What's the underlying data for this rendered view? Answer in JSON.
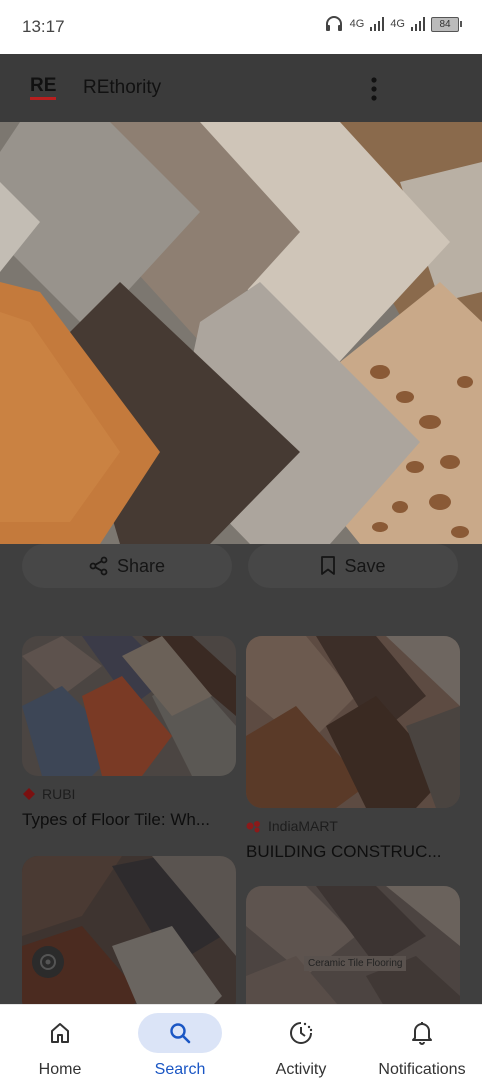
{
  "status_bar": {
    "time": "13:17",
    "network_1": "4G",
    "network_2": "4G",
    "battery": "84"
  },
  "header": {
    "logo": "RE",
    "site_name": "REthority",
    "menu_icon": "more-vert-icon"
  },
  "hero_image": {
    "description_icon": "tile-samples-photo"
  },
  "actions": {
    "share_label": "Share",
    "share_icon": "share-icon",
    "save_label": "Save",
    "save_icon": "bookmark-icon"
  },
  "results": [
    {
      "source": "RUBI",
      "title": "Types of Floor Tile: Wh...",
      "source_icon": "rubi-logo-icon"
    },
    {
      "source": "IndiaMART",
      "title": "BUILDING CONSTRUC...",
      "source_icon": "indiamart-logo-icon"
    },
    {
      "source": "",
      "title": "",
      "overlay_icon": "lens-icon"
    },
    {
      "overlay_text": "Ceramic Tile Flooring"
    }
  ],
  "bottom_nav": {
    "items": [
      {
        "label": "Home",
        "icon": "home-icon",
        "active": false
      },
      {
        "label": "Search",
        "icon": "search-icon",
        "active": true
      },
      {
        "label": "Activity",
        "icon": "activity-icon",
        "active": false
      },
      {
        "label": "Notifications",
        "icon": "bell-icon",
        "active": false
      }
    ]
  },
  "colors": {
    "accent": "#1a56c4",
    "active_pill": "#dbe4f7",
    "logo_underline": "#b81f1f",
    "scrim": "#3f3f3f"
  }
}
